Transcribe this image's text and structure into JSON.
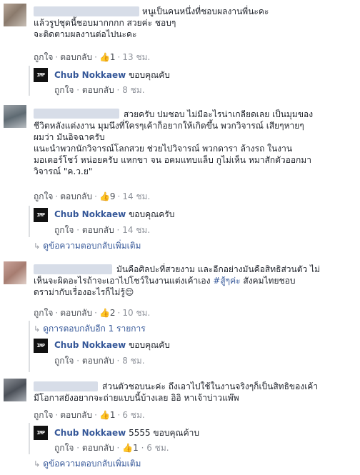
{
  "comments": [
    {
      "text": "หนูเป็นคนหนึ่งที่ชอบผลงานพี่นะคะ\nแล้วรูปชุดนี้ชอบมากกกก สวยค่ะ ชอบๆ\nจะติดตามผลงานต่อไปนะคะ",
      "like_label": "ถูกใจ",
      "reply_label": "ตอบกลับ",
      "likes": "1",
      "time": "13 ชม.",
      "reply": {
        "avatar_text": "IMP",
        "name": "Chub Nokkaew",
        "text": "ขอบคุณคับ",
        "like_label": "ถูกใจ",
        "reply_label": "ตอบกลับ",
        "time": "8 ชม."
      }
    },
    {
      "text": "สวยครับ ปมชอบ ไม่มีอะไรน่าเกลียดเลย เป็นมุมของ\nชีวิตหลังแต่งงาน มุมนึงที่ใครๆเค้าก็อยากให้เกิดขึ้น พวกวิจารณ์ เสียๆหายๆ\nผมว่า มันอิจฉาครับ\nแนะนำพวกนักวิจารณ์โลกสวย ช่วยไปวิจารณ์ พวกดารา ล้างรถ ในงาน\nมอเตอร์โชว์ หน่อยครับ แหกขา จน อคมแทบแล็บ กูไม่เห็น หมาสักตัวออกมา\nวิจารณ์ \"ค.ว.ย\"",
      "like_label": "ถูกใจ",
      "reply_label": "ตอบกลับ",
      "likes": "9",
      "time": "14 ชม.",
      "reply": {
        "avatar_text": "IMP",
        "name": "Chub Nokkaew",
        "text": "ขอบคุณครับ",
        "like_label": "ถูกใจ",
        "reply_label": "ตอบกลับ",
        "time": "14 ชม."
      },
      "more_label": "ดูข้อความตอบกลับเพิ่มเติม"
    },
    {
      "text_before": "มันคือศิลปะที่สวยงาม และอีกอย่างมันคือสิทธิส่วนตัว ไม่\nเห็นจะผิดอะไรถ้าจะเอาไปโชว์ในงานแต่งเค้าเอง ",
      "hashtag": "#สู้ๆค่ะ",
      "text_after": " สังคมไทยชอบ\nดราม่ากับเรื่องอะไรก็ไม่รู้😌",
      "like_label": "ถูกใจ",
      "reply_label": "ตอบกลับ",
      "likes": "2",
      "time": "10 ชม.",
      "prev_label": "ดูการตอบกลับอีก 1 รายการ",
      "reply": {
        "avatar_text": "IMP",
        "name": "Chub Nokkaew",
        "text": "ขอบคุณคับ",
        "like_label": "ถูกใจ",
        "reply_label": "ตอบกลับ",
        "time": "8 ชม."
      }
    },
    {
      "text": "ส่วนตัวชอบนะค่ะ ถึงเอาไปใช้ในงานจริงๆก็เป็นสิทธิของเค้า\nมีโอกาสยังอยากจะถ่ายแบบนี้บ้างเลย อิอิ หาเจ้าบ่าวแพ๊พ",
      "like_label": "ถูกใจ",
      "reply_label": "ตอบกลับ",
      "likes": "1",
      "time": "6 ชม.",
      "reply": {
        "avatar_text": "IMP",
        "name": "Chub Nokkaew",
        "text": "5555 ขอบคุณค้าบ",
        "like_label": "ถูกใจ",
        "reply_label": "ตอบกลับ",
        "likes": "1",
        "time": "6 ชม."
      },
      "more_label": "ดูข้อความตอบกลับเพิ่มเติม"
    }
  ]
}
